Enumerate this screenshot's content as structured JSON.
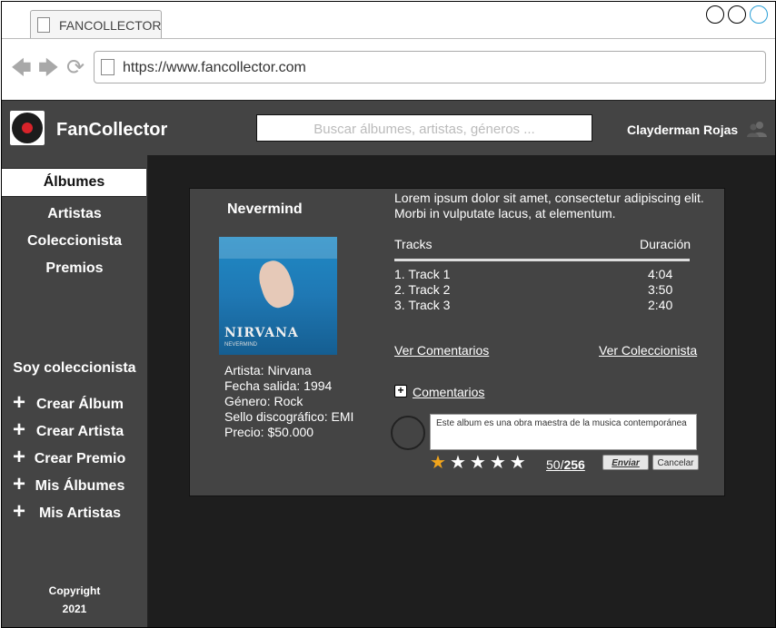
{
  "browser": {
    "tab_title": "FANCOLLECTOR",
    "url": "https://www.fancollector.com"
  },
  "header": {
    "brand": "FanCollector",
    "search_placeholder": "Buscar álbumes, artistas, géneros ...",
    "user_name": "Clayderman Rojas"
  },
  "sidebar": {
    "items": [
      {
        "label": "Álbumes",
        "active": true
      },
      {
        "label": "Artistas",
        "active": false
      },
      {
        "label": "Coleccionista",
        "active": false
      },
      {
        "label": "Premios",
        "active": false
      }
    ],
    "section_title": "Soy coleccionista",
    "actions": [
      {
        "label": "Crear Álbum"
      },
      {
        "label": "Crear Artista"
      },
      {
        "label": "Crear Premio"
      },
      {
        "label": "Mis Álbumes"
      },
      {
        "label": "Mis Artistas"
      }
    ],
    "copyright_line1": "Copyright",
    "copyright_line2": "2021"
  },
  "album": {
    "title": "Nevermind",
    "cover_text": "NIRVANA",
    "cover_subtext": "NEVERMIND",
    "artist": "Artista: Nirvana",
    "release": "Fecha salida: 1994",
    "genre": "Género: Rock",
    "label": "Sello discográfico: EMI",
    "price": "Precio: $50.000",
    "description": "Lorem ipsum dolor sit amet, consectetur adipiscing elit. Morbi in vulputate lacus, at elementum.",
    "tracks_header": "Tracks",
    "duration_header": "Duración",
    "tracks": [
      {
        "name": "1. Track 1",
        "duration": "4:04"
      },
      {
        "name": "2. Track 2",
        "duration": "3:50"
      },
      {
        "name": "3. Track 3",
        "duration": "2:40"
      }
    ],
    "link_comments": "Ver Comentarios",
    "link_collector": "Ver Coleccionista",
    "comments_label": "Comentarios",
    "comment_text": "Este album es una obra maestra de la musica contemporánea",
    "stars_filled": 1,
    "stars_total": 5,
    "rating_current": "50",
    "rating_total": "256",
    "send_button": "Enviar",
    "cancel_button": "Cancelar"
  },
  "colors": {
    "accent_star": "#f2a51c",
    "header_bg": "#444444",
    "main_bg": "#1e1e1e",
    "vinyl_label": "#d8232a"
  }
}
